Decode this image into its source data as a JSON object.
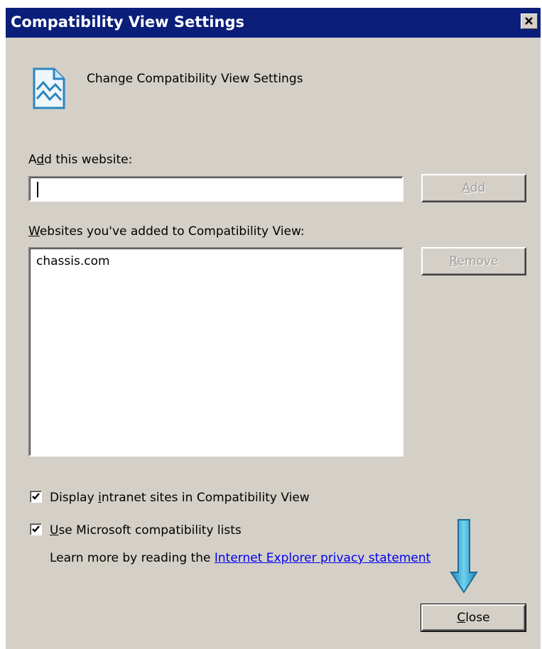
{
  "window": {
    "title": "Compatibility View Settings"
  },
  "header": {
    "text": "Change Compatibility View Settings",
    "icon": "compatibility-view-icon"
  },
  "add_website": {
    "label_prefix": "A",
    "label_mnemonic": "d",
    "label_rest": "d this website:",
    "input_value": "",
    "add_button": {
      "mnemonic": "A",
      "rest": "dd"
    }
  },
  "websites_list": {
    "label_mnemonic": "W",
    "label_rest": "ebsites you've added to Compatibility View:",
    "items": [
      "chassis.com"
    ],
    "remove_button": {
      "mnemonic": "R",
      "rest": "emove"
    }
  },
  "options": {
    "intranet": {
      "checked": true,
      "label_prefix": "Display ",
      "label_mnemonic": "i",
      "label_rest": "ntranet sites in Compatibility View"
    },
    "ms_lists": {
      "checked": true,
      "label_mnemonic": "U",
      "label_rest": "se Microsoft compatibility lists"
    }
  },
  "learn_more": {
    "text": "Learn more by reading the ",
    "link_text": "Internet Explorer privacy statement"
  },
  "close_button": {
    "mnemonic": "C",
    "rest": "lose"
  },
  "annotation": {
    "icon": "down-arrow-icon",
    "color": "#3aa0c8"
  },
  "colors": {
    "titlebar": "#0a1e7a",
    "dialog_bg": "#d4d0c8",
    "link": "#0000ee"
  }
}
